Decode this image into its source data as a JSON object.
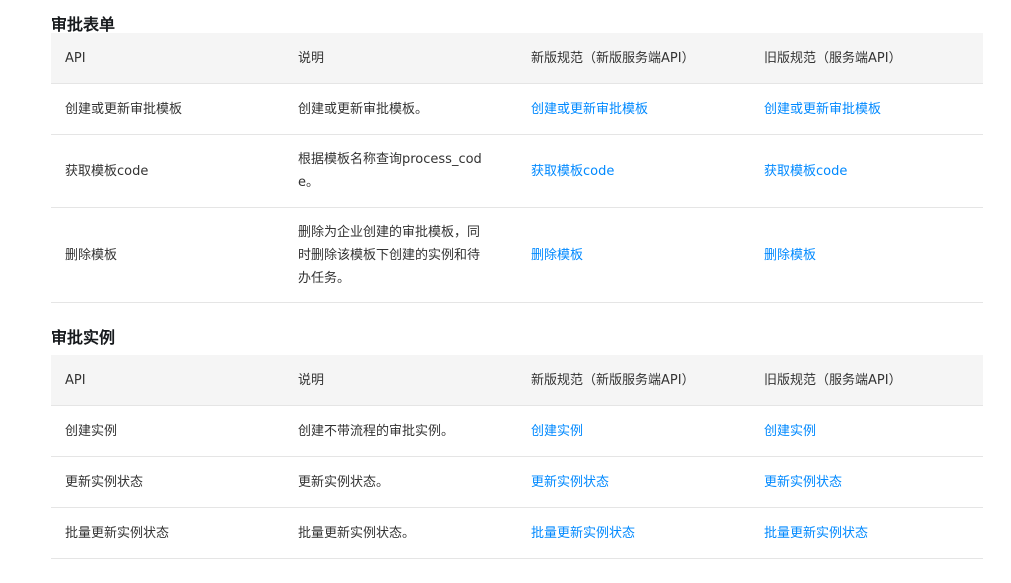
{
  "sections": [
    {
      "title": "审批表单",
      "headers": [
        "API",
        "说明",
        "新版规范（新版服务端API）",
        "旧版规范（服务端API）"
      ],
      "rows": [
        {
          "api": "创建或更新审批模板",
          "desc": "创建或更新审批模板。",
          "new_link": "创建或更新审批模板",
          "old_link": "创建或更新审批模板"
        },
        {
          "api": "获取模板code",
          "desc": "根据模板名称查询process_code。",
          "new_link": "获取模板code",
          "old_link": "获取模板code"
        },
        {
          "api": "删除模板",
          "desc": "删除为企业创建的审批模板，同时删除该模板下创建的实例和待办任务。",
          "new_link": "删除模板",
          "old_link": "删除模板"
        }
      ]
    },
    {
      "title": "审批实例",
      "headers": [
        "API",
        "说明",
        "新版规范（新版服务端API）",
        "旧版规范（服务端API）"
      ],
      "rows": [
        {
          "api": "创建实例",
          "desc": "创建不带流程的审批实例。",
          "new_link": "创建实例",
          "old_link": "创建实例"
        },
        {
          "api": "更新实例状态",
          "desc": "更新实例状态。",
          "new_link": "更新实例状态",
          "old_link": "更新实例状态"
        },
        {
          "api": "批量更新实例状态",
          "desc": "批量更新实例状态。",
          "new_link": "批量更新实例状态",
          "old_link": "批量更新实例状态"
        }
      ]
    }
  ],
  "colors": {
    "link": "#0089ff",
    "header_bg": "#f5f5f5",
    "border": "#e5e5e5"
  }
}
